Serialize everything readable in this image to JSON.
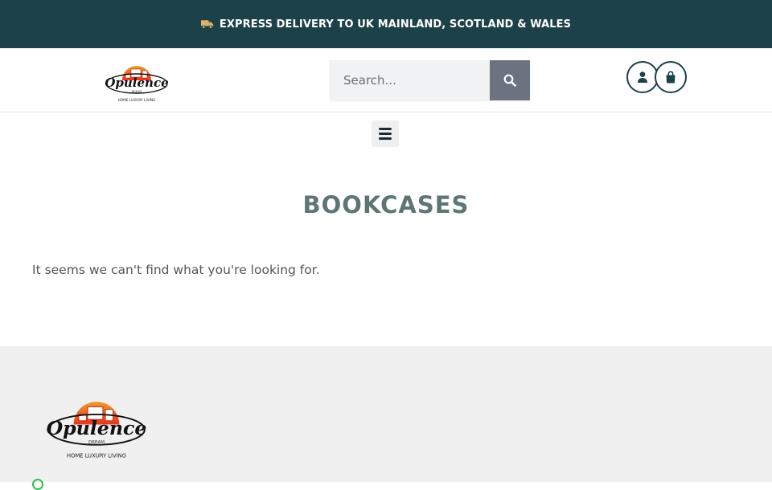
{
  "topbar": {
    "icon": "truck-icon",
    "message": "EXPRESS DELIVERY TO UK MAINLAND, SCOTLAND & WALES",
    "background": "#1c4149"
  },
  "header": {
    "logo": {
      "name": "Opulence",
      "subname": "DREAM",
      "tagline": "HOME LUXURY LIVING"
    },
    "search": {
      "placeholder": "Search...",
      "value": "",
      "button_icon": "search-icon"
    },
    "account_icon": "user-icon",
    "cart_icon": "shopping-bag-icon"
  },
  "nav": {
    "menu_icon": "hamburger-menu-icon"
  },
  "page": {
    "title": "BOOKCASES",
    "empty_message": "It seems we can't find what you're looking for."
  },
  "footer": {
    "logo": {
      "name": "Opulence",
      "subname": "DREAM",
      "tagline": "HOME LUXURY LIVING"
    },
    "contact_icon": "whatsapp-icon"
  },
  "colors": {
    "brand_dark": "#1c4149",
    "title": "#5e7673",
    "logo_red": "#e8341c",
    "logo_orange": "#f39a2b",
    "search_button": "#6b7280"
  }
}
